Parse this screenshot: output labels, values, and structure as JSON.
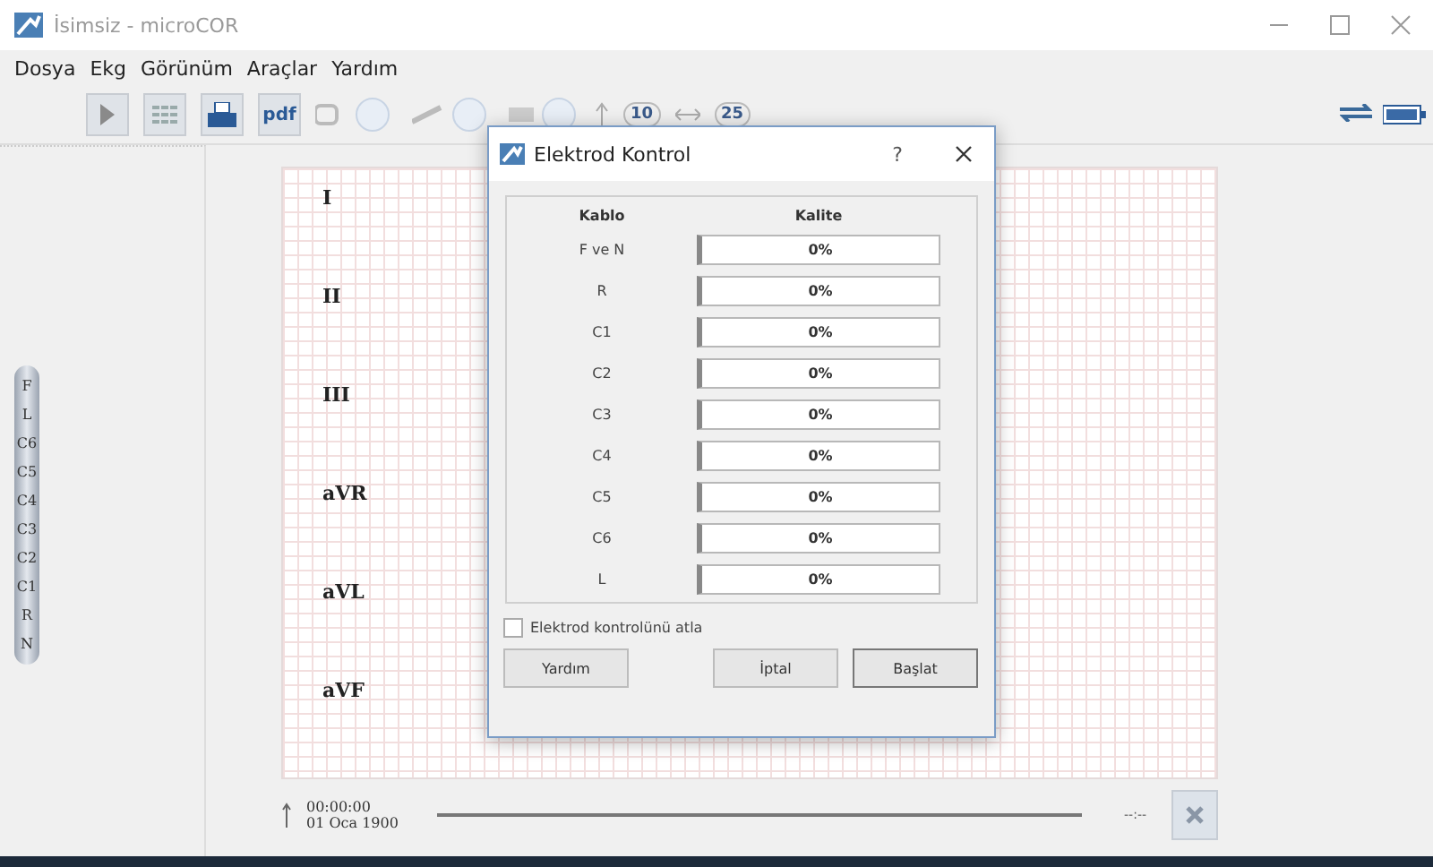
{
  "window": {
    "title": "İsimsiz - microCOR"
  },
  "menu": [
    "Dosya",
    "Ekg",
    "Görünüm",
    "Araçlar",
    "Yardım"
  ],
  "toolbar": {
    "pdf": "pdf",
    "speed": "10",
    "gain": "25"
  },
  "electrodes": [
    "F",
    "L",
    "C6",
    "C5",
    "C4",
    "C3",
    "C2",
    "C1",
    "R",
    "N"
  ],
  "leads": [
    "I",
    "II",
    "III",
    "aVR",
    "aVL",
    "aVF"
  ],
  "timeline": {
    "time": "00:00:00",
    "date": "01 Oca 1900",
    "position": "--:--"
  },
  "dialog": {
    "title": "Elektrod Kontrol",
    "help_mark": "?",
    "columns": [
      "Kablo",
      "Kalite"
    ],
    "rows": [
      {
        "cable": "F ve N",
        "level": 0,
        "reading": "0%"
      },
      {
        "cable": "R",
        "level": 0,
        "reading": "0%"
      },
      {
        "cable": "C1",
        "level": 0,
        "reading": "0%"
      },
      {
        "cable": "C2",
        "level": 0,
        "reading": "0%"
      },
      {
        "cable": "C3",
        "level": 0,
        "reading": "0%"
      },
      {
        "cable": "C4",
        "level": 0,
        "reading": "0%"
      },
      {
        "cable": "C5",
        "level": 0,
        "reading": "0%"
      },
      {
        "cable": "C6",
        "level": 0,
        "reading": "0%"
      },
      {
        "cable": "L",
        "level": 0,
        "reading": "0%"
      }
    ],
    "skip": {
      "label": "Elektrod kontrolünü atla",
      "checked": false
    },
    "buttons": [
      "Yardım",
      "İptal",
      "Başlat"
    ]
  }
}
